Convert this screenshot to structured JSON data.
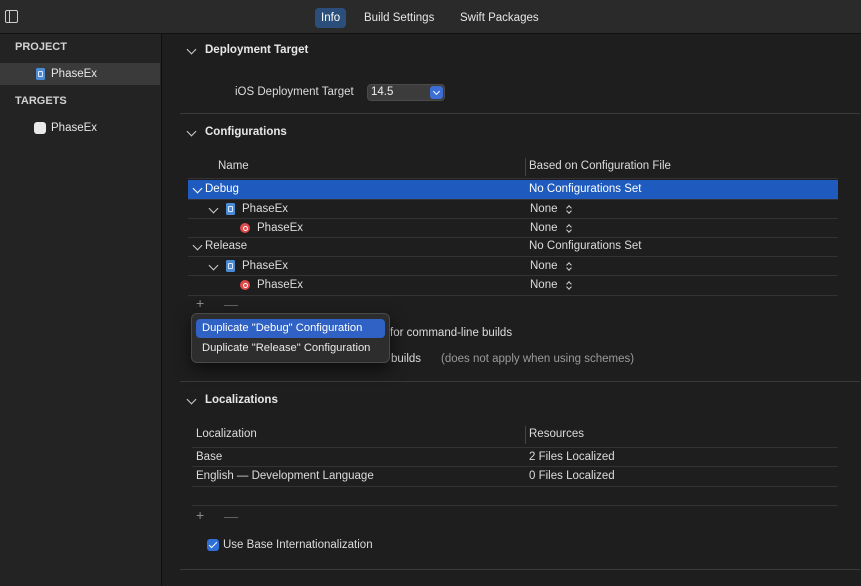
{
  "tabs": [
    {
      "label": "Info"
    },
    {
      "label": "Build Settings"
    },
    {
      "label": "Swift Packages"
    }
  ],
  "sidebar": {
    "project_header": "PROJECT",
    "project_item": "PhaseEx",
    "targets_header": "TARGETS",
    "target_item": "PhaseEx"
  },
  "deployment": {
    "title": "Deployment Target",
    "label": "iOS Deployment Target",
    "value": "14.5"
  },
  "configurations": {
    "title": "Configurations",
    "col_name": "Name",
    "col_file": "Based on Configuration File",
    "rows": [
      {
        "name": "Debug",
        "file": "No Configurations Set"
      },
      {
        "name": "PhaseEx",
        "file": "None"
      },
      {
        "name": "PhaseEx",
        "file": "None"
      },
      {
        "name": "Release",
        "file": "No Configurations Set"
      },
      {
        "name": "PhaseEx",
        "file": "None"
      },
      {
        "name": "PhaseEx",
        "file": "None"
      }
    ],
    "add": "+",
    "remove": "—",
    "cmdline_text": "for command-line builds",
    "scheme_text": "ne builds",
    "scheme_note": "(does not apply when using schemes)"
  },
  "popup": {
    "items": [
      "Duplicate \"Debug\" Configuration",
      "Duplicate \"Release\" Configuration"
    ]
  },
  "localizations": {
    "title": "Localizations",
    "col_loc": "Localization",
    "col_res": "Resources",
    "rows": [
      {
        "name": "Base",
        "res": "2 Files Localized"
      },
      {
        "name": "English — Development Language",
        "res": "0 Files Localized"
      }
    ],
    "add": "+",
    "remove": "—",
    "base_intl_label": "Use Base Internationalization"
  },
  "colors": {
    "selection": "#1f5bbf",
    "accent": "#2f6fd8",
    "background": "#1e1e1e"
  }
}
